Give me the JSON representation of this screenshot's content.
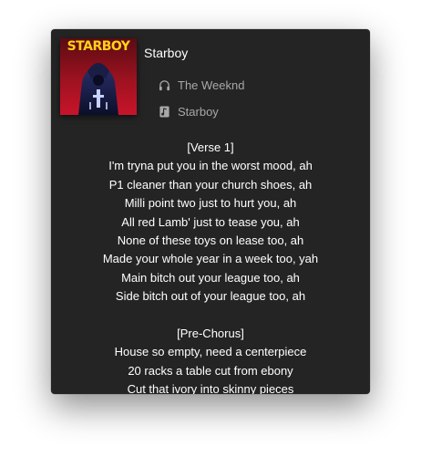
{
  "track": {
    "title": "Starboy",
    "artist": "The Weeknd",
    "album": "Starboy",
    "cover_text": "STARBOY",
    "icons": {
      "artist": "headphones-icon",
      "album": "music-note-icon"
    }
  },
  "lyrics": {
    "section1": "[Verse 1]",
    "lines1": [
      "I'm tryna put you in the worst mood, ah",
      "P1 cleaner than your church shoes, ah",
      "Milli point two just to hurt you, ah",
      "All red Lamb' just to tease you, ah",
      "None of these toys on lease too, ah",
      "Made your whole year in a week too, yah",
      "Main bitch out your league too, ah",
      "Side bitch out of your league too, ah"
    ],
    "section2": "[Pre-Chorus]",
    "lines2": [
      "House so empty, need a centerpiece",
      "20 racks a table cut from ebony",
      "Cut that ivory into skinny pieces"
    ]
  },
  "colors": {
    "window_bg": "#242424",
    "text_primary": "#ffffff",
    "text_secondary": "#a8a8a8",
    "cover_accent": "#ffd21a"
  }
}
